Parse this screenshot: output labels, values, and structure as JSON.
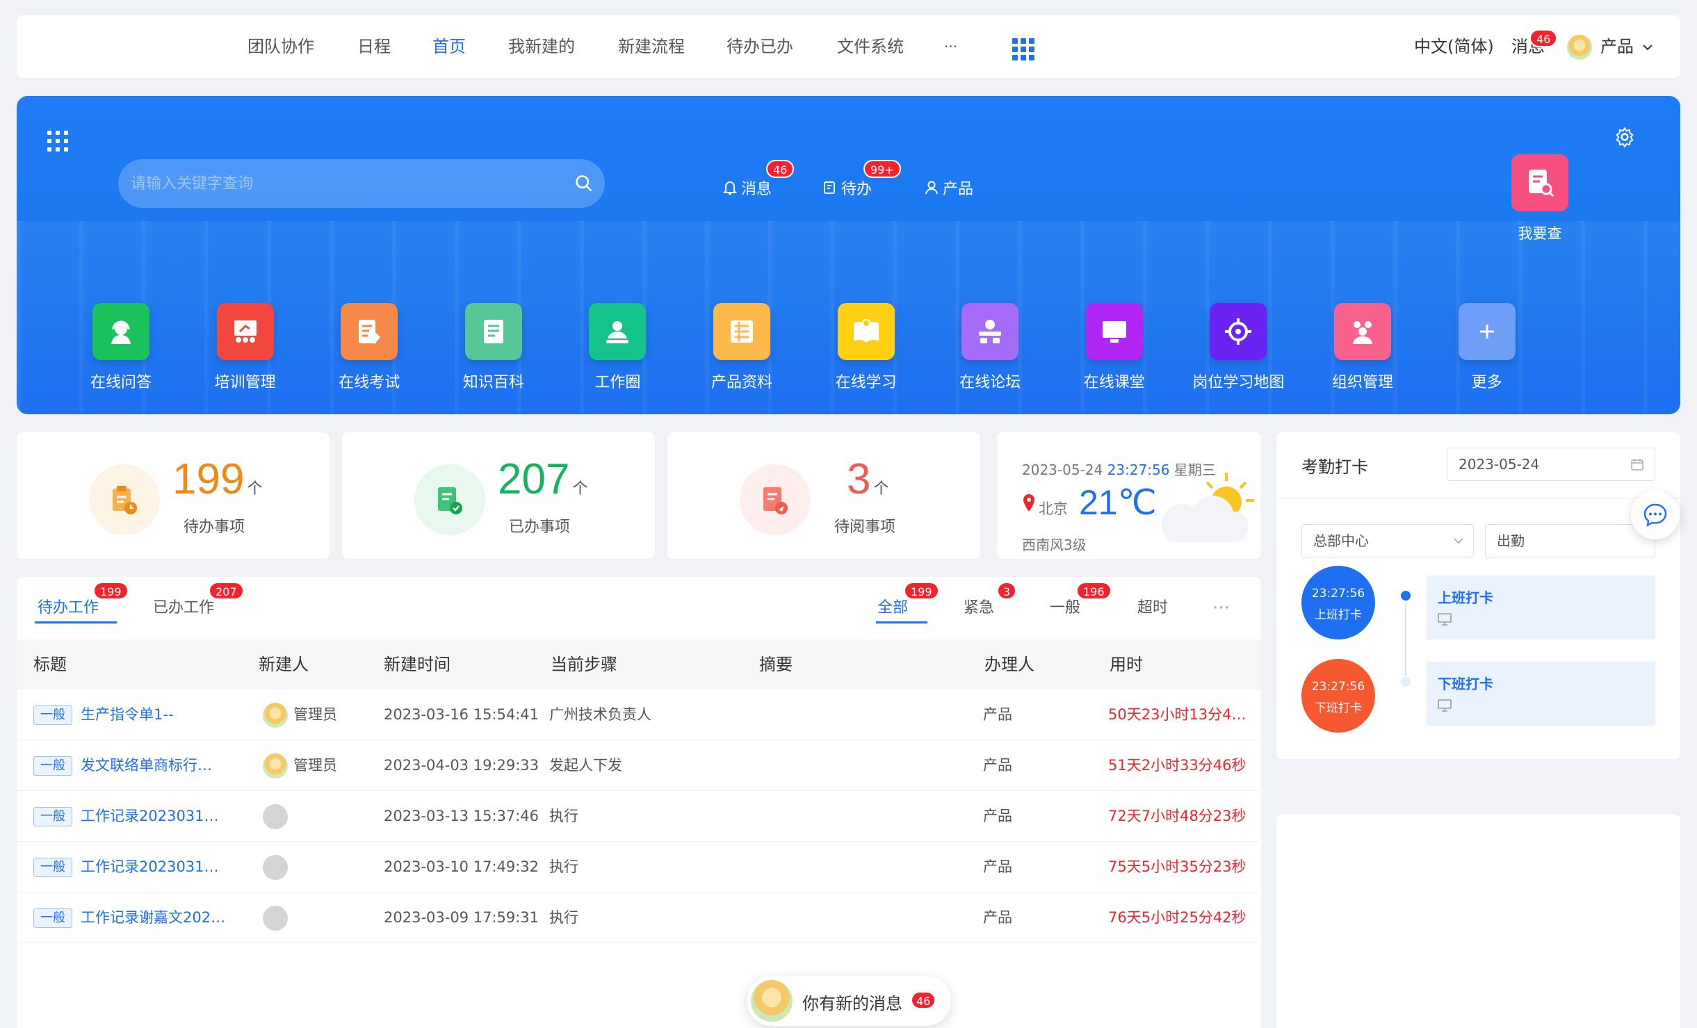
{
  "topnav": {
    "items": [
      "团队协作",
      "日程",
      "首页",
      "我新建的",
      "新建流程",
      "待办已办",
      "文件系统",
      "···"
    ],
    "active_index": 2,
    "language": "中文(简体)",
    "messages_label": "消息",
    "messages_count": "46",
    "user_name": "产品"
  },
  "hero": {
    "search_placeholder": "请输入关键字查询",
    "links": [
      {
        "label": "消息",
        "badge": "46"
      },
      {
        "label": "待办",
        "badge": "99+"
      },
      {
        "label": "产品",
        "badge": ""
      }
    ],
    "quick_action": "我要查",
    "tiles": [
      {
        "label": "在线问答",
        "color": "#19c25a",
        "icon": "support-agent-icon"
      },
      {
        "label": "培训管理",
        "color": "#f2473f",
        "icon": "training-board-icon"
      },
      {
        "label": "在线考试",
        "color": "#f6884a",
        "icon": "exam-pencil-icon"
      },
      {
        "label": "知识百科",
        "color": "#56c796",
        "icon": "book-icon"
      },
      {
        "label": "工作圈",
        "color": "#14c38a",
        "icon": "work-circle-icon"
      },
      {
        "label": "产品资料",
        "color": "#fcb84a",
        "icon": "product-docs-icon"
      },
      {
        "label": "在线学习",
        "color": "#ffd012",
        "icon": "open-book-icon"
      },
      {
        "label": "在线论坛",
        "color": "#a46cf7",
        "icon": "forum-icon"
      },
      {
        "label": "在线课堂",
        "color": "#b026f5",
        "icon": "monitor-icon"
      },
      {
        "label": "岗位学习地图",
        "color": "#6a23f2",
        "icon": "target-icon"
      },
      {
        "label": "组织管理",
        "color": "#f8628c",
        "icon": "organization-icon"
      },
      {
        "label": "更多",
        "color": "#6f9ef8",
        "icon": "plus-icon"
      }
    ]
  },
  "stats": [
    {
      "value": "199",
      "unit": "个",
      "label": "待办事项",
      "color": "#f08a16",
      "bg": "#fdf4e6"
    },
    {
      "value": "207",
      "unit": "个",
      "label": "已办事项",
      "color": "#14b35e",
      "bg": "#e9f8ef"
    },
    {
      "value": "3",
      "unit": "个",
      "label": "待阅事项",
      "color": "#f05a4f",
      "bg": "#feeeed"
    }
  ],
  "weather": {
    "date": "2023-05-24",
    "time": "23:27:56",
    "weekday": "星期三",
    "city": "北京",
    "temp": "21℃",
    "wind": "西南风3级"
  },
  "tasks": {
    "tabs": [
      {
        "label": "待办工作",
        "badge": "199"
      },
      {
        "label": "已办工作",
        "badge": "207"
      }
    ],
    "filters": [
      {
        "label": "全部",
        "badge": "199"
      },
      {
        "label": "紧急",
        "badge": "3"
      },
      {
        "label": "一般",
        "badge": "196"
      },
      {
        "label": "超时",
        "badge": ""
      }
    ],
    "more": "···",
    "columns": [
      "标题",
      "新建人",
      "新建时间",
      "当前步骤",
      "摘要",
      "办理人",
      "用时"
    ],
    "rows": [
      {
        "tag": "一般",
        "title": "生产指令单1--",
        "creator": "管理员",
        "time": "2023-03-16 15:54:41",
        "step": "广州技术负责人",
        "summary": "",
        "handler": "产品",
        "duration": "50天23小时13分4…"
      },
      {
        "tag": "一般",
        "title": "发文联络单商标行…",
        "creator": "管理员",
        "time": "2023-04-03 19:29:33",
        "step": "发起人下发",
        "summary": "",
        "handler": "产品",
        "duration": "51天2小时33分46秒"
      },
      {
        "tag": "一般",
        "title": "工作记录20230313…",
        "creator": "",
        "time": "2023-03-13 15:37:46",
        "step": "执行",
        "summary": "",
        "handler": "产品",
        "duration": "72天7小时48分23秒"
      },
      {
        "tag": "一般",
        "title": "工作记录20230310…",
        "creator": "",
        "time": "2023-03-10 17:49:32",
        "step": "执行",
        "summary": "",
        "handler": "产品",
        "duration": "75天5小时35分23秒"
      },
      {
        "tag": "一般",
        "title": "工作记录谢嘉文202…",
        "creator": "",
        "time": "2023-03-09 17:59:31",
        "step": "执行",
        "summary": "",
        "handler": "产品",
        "duration": "76天5小时25分42秒"
      }
    ]
  },
  "attendance": {
    "title": "考勤打卡",
    "date": "2023-05-24",
    "org": "总部中心",
    "type": "出勤",
    "checkin": {
      "time": "23:27:56",
      "label": "上班打卡",
      "card": "上班打卡"
    },
    "checkout": {
      "time": "23:27:56",
      "label": "下班打卡",
      "card": "下班打卡"
    }
  },
  "notification": {
    "text": "你有新的消息",
    "count": "46"
  }
}
